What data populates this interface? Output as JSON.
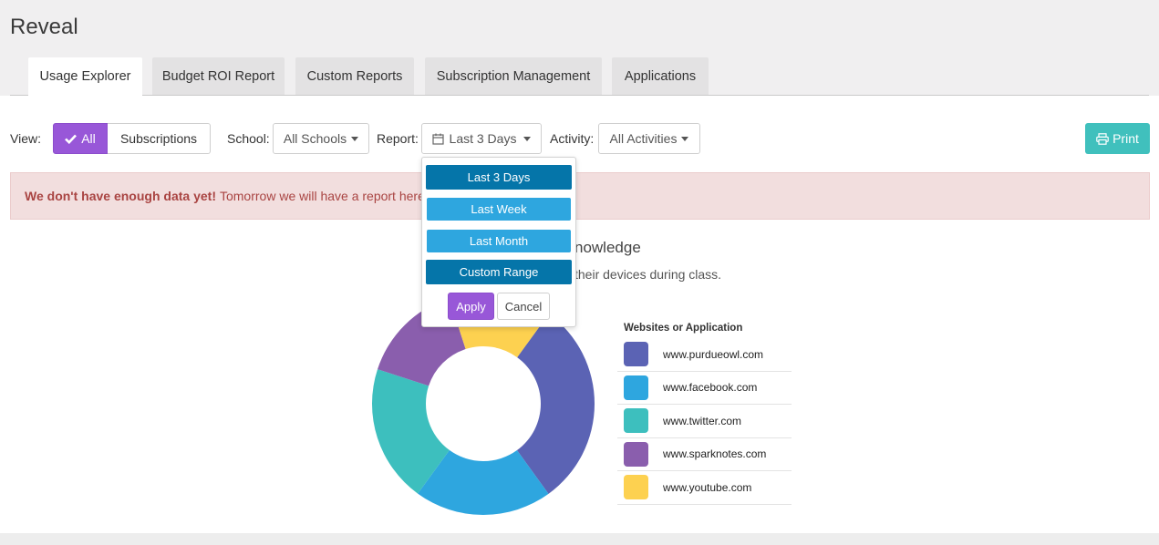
{
  "app": {
    "title": "Reveal"
  },
  "tabs": [
    {
      "label": "Usage Explorer",
      "active": true
    },
    {
      "label": "Budget ROI Report",
      "active": false
    },
    {
      "label": "Custom Reports",
      "active": false
    },
    {
      "label": "Subscription Management",
      "active": false
    },
    {
      "label": "Applications",
      "active": false
    }
  ],
  "filters": {
    "view_label": "View:",
    "view_all": "All",
    "view_subscriptions": "Subscriptions",
    "school_label": "School:",
    "school_value": "All Schools",
    "report_label": "Report:",
    "report_value": "Last 3 Days",
    "activity_label": "Activity:",
    "activity_value": "All Activities",
    "print_label": "Print"
  },
  "alert": {
    "strong": "We don't have enough data yet!",
    "text": "Tomorrow we will have a report here."
  },
  "chart_header": {
    "title_fragment": "nowledge",
    "subtitle_fragment": "their devices during class."
  },
  "report_dropdown": {
    "options": [
      "Last 3 Days",
      "Last Week",
      "Last Month",
      "Custom Range"
    ],
    "selected": "Last 3 Days",
    "apply_label": "Apply",
    "cancel_label": "Cancel"
  },
  "colors": {
    "accent_purple": "#9857d8",
    "print_teal": "#40c0bd",
    "dropdown_dark": "#0575a9",
    "dropdown_light": "#2ea6df",
    "alert_bg": "#f2dede",
    "alert_text": "#a94442"
  },
  "chart_data": {
    "type": "pie",
    "donut": true,
    "legend_title": "Websites or Application",
    "categories": [
      "www.purdueowl.com",
      "www.facebook.com",
      "www.twitter.com",
      "www.sparknotes.com",
      "www.youtube.com"
    ],
    "values": [
      30,
      20,
      20,
      15,
      15
    ],
    "colors": [
      "#5b63b4",
      "#2ea6df",
      "#3dbfbe",
      "#8a5ead",
      "#fdd150"
    ]
  }
}
